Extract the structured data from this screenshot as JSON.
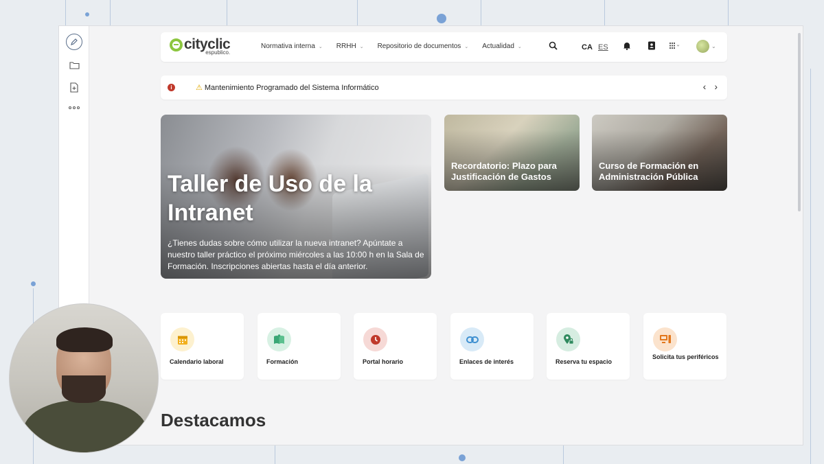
{
  "header": {
    "logo_main": "cityclic",
    "logo_sub": "espublico.",
    "nav": [
      {
        "label": "Normativa interna"
      },
      {
        "label": "RRHH"
      },
      {
        "label": "Repositorio de documentos"
      },
      {
        "label": "Actualidad"
      }
    ],
    "lang_ca": "CA",
    "lang_es": "ES",
    "icons": [
      "search-icon",
      "bell-icon",
      "contacts-icon",
      "apps-grid-icon",
      "avatar"
    ]
  },
  "alert": {
    "text": "Mantenimiento Programado del Sistema Informático"
  },
  "hero": {
    "title": "Taller de Uso de la Intranet",
    "description": "¿Tienes dudas sobre cómo utilizar la nueva intranet? Apúntate a nuestro taller práctico el próximo miércoles a las 10:00 h en la Sala de Formación. Inscripciones abiertas hasta el día anterior."
  },
  "cards": [
    {
      "title": "Recordatorio: Plazo para Justificación de Gastos"
    },
    {
      "title": "Curso de Formación en Administración Pública"
    }
  ],
  "quick_links": [
    {
      "label": "Calendario laboral",
      "icon": "calendar-icon",
      "color": "#f2b01e",
      "bg": "#fdf1cf"
    },
    {
      "label": "Formación",
      "icon": "book-icon",
      "color": "#3aa776",
      "bg": "#d8f1e4"
    },
    {
      "label": "Portal horario",
      "icon": "clock-icon",
      "color": "#c0392b",
      "bg": "#f6d9d6"
    },
    {
      "label": "Enlaces de interés",
      "icon": "link-icon",
      "color": "#3d8fd0",
      "bg": "#d8eaf7"
    },
    {
      "label": "Reserva tu espacio",
      "icon": "location-lock-icon",
      "color": "#2f8a5e",
      "bg": "#d6ede1"
    },
    {
      "label": "Solicita tus periféricos",
      "icon": "computer-icon",
      "color": "#e2771c",
      "bg": "#fbe3cd"
    }
  ],
  "section": {
    "title": "Destacamos"
  }
}
